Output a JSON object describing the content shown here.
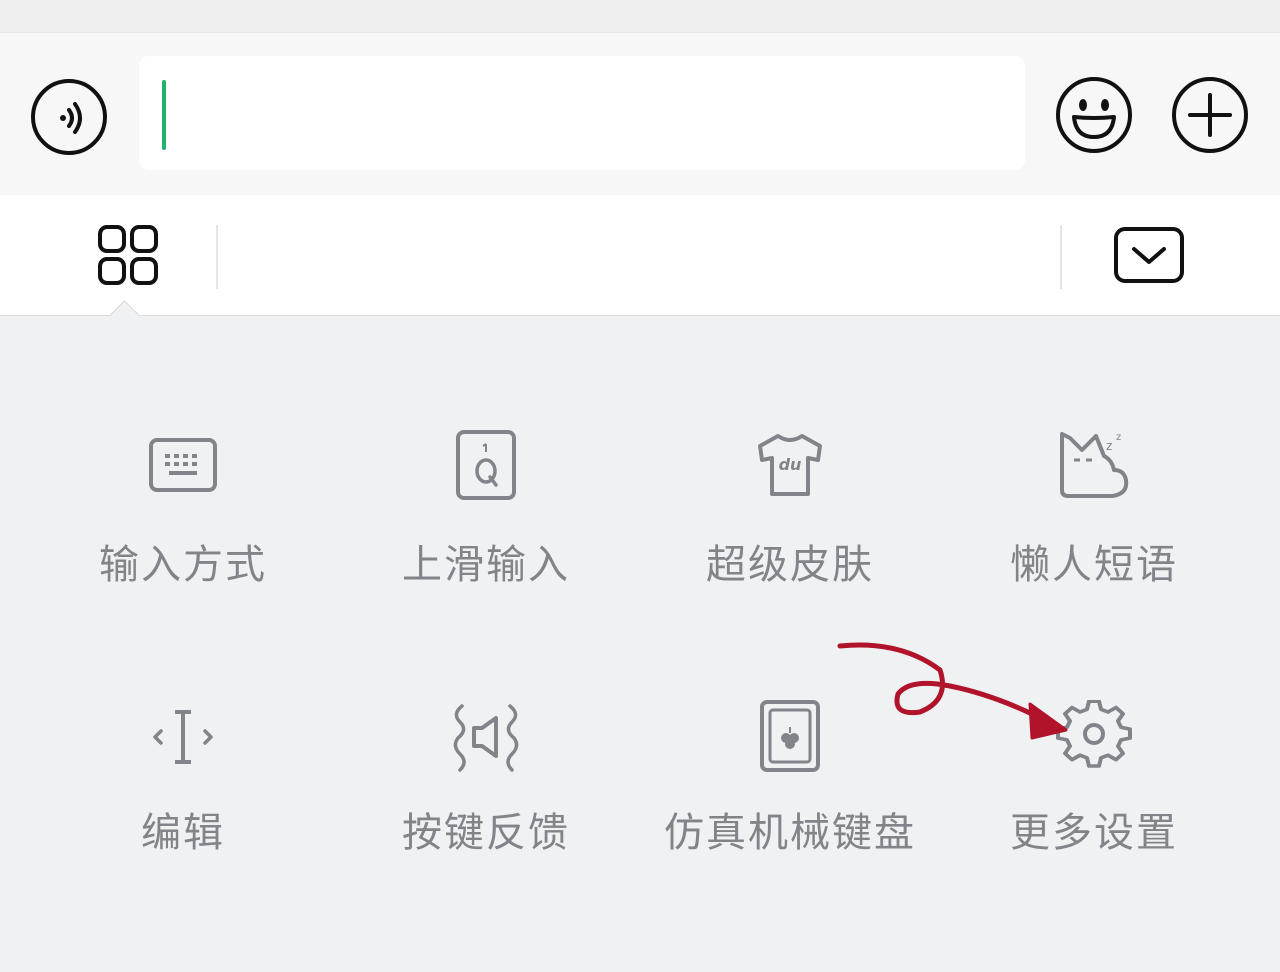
{
  "input_bar": {
    "voice_icon": "voice-icon",
    "text_value": "",
    "emoji_icon": "emoji-icon",
    "plus_icon": "plus-icon"
  },
  "toolbar": {
    "menu_icon": "grid-menu-icon",
    "collapse_icon": "keyboard-collapse-icon"
  },
  "panel": {
    "items": [
      {
        "label": "输入方式",
        "icon": "keyboard-icon"
      },
      {
        "label": "上滑输入",
        "icon": "swipe-key-icon"
      },
      {
        "label": "超级皮肤",
        "icon": "skin-shirt-icon"
      },
      {
        "label": "懒人短语",
        "icon": "sleepy-cat-icon"
      },
      {
        "label": "编辑",
        "icon": "cursor-edit-icon"
      },
      {
        "label": "按键反馈",
        "icon": "key-feedback-icon"
      },
      {
        "label": "仿真机械键盘",
        "icon": "mechanical-keyboard-icon"
      },
      {
        "label": "更多设置",
        "icon": "gear-icon"
      }
    ]
  },
  "colors": {
    "caret": "#21b36b",
    "label": "#818589",
    "icon": "#818589",
    "annotation": "#b0132a"
  }
}
